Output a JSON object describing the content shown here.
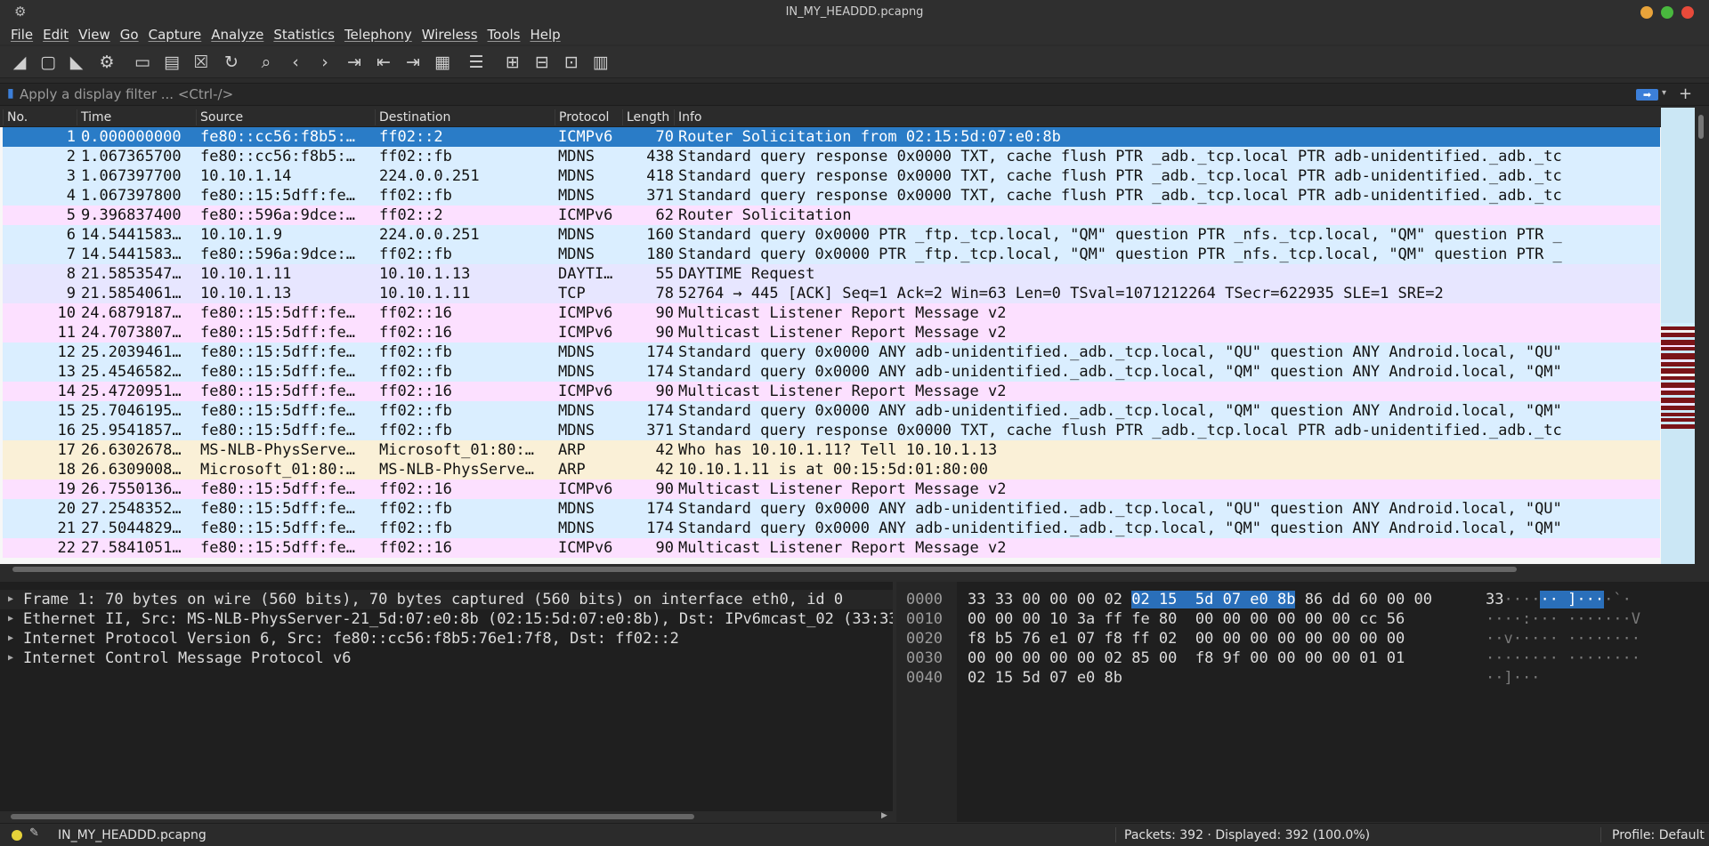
{
  "window": {
    "title": "IN_MY_HEADDD.pcapng"
  },
  "menu": [
    "File",
    "Edit",
    "View",
    "Go",
    "Capture",
    "Analyze",
    "Statistics",
    "Telephony",
    "Wireless",
    "Tools",
    "Help"
  ],
  "filter": {
    "placeholder": "Apply a display filter ... <Ctrl-/>"
  },
  "columns": [
    "No.",
    "Time",
    "Source",
    "Destination",
    "Protocol",
    "Length",
    "Info"
  ],
  "colors": {
    "selected": "#2a7cc7",
    "icmpv6": "#fce0ff",
    "udp": "#daeeff",
    "tcp": "#e7e6ff",
    "arp": "#faf0d7"
  },
  "packets": [
    {
      "no": "1",
      "time": "0.000000000",
      "src": "fe80::cc56:f8b5:…",
      "dst": "ff02::2",
      "proto": "ICMPv6",
      "len": "70",
      "info": "Router Solicitation from 02:15:5d:07:e0:8b",
      "color": "selected"
    },
    {
      "no": "2",
      "time": "1.067365700",
      "src": "fe80::cc56:f8b5:…",
      "dst": "ff02::fb",
      "proto": "MDNS",
      "len": "438",
      "info": "Standard query response 0x0000 TXT, cache flush PTR _adb._tcp.local PTR adb-unidentified._adb._tc",
      "color": "udp"
    },
    {
      "no": "3",
      "time": "1.067397700",
      "src": "10.10.1.14",
      "dst": "224.0.0.251",
      "proto": "MDNS",
      "len": "418",
      "info": "Standard query response 0x0000 TXT, cache flush PTR _adb._tcp.local PTR adb-unidentified._adb._tc",
      "color": "udp"
    },
    {
      "no": "4",
      "time": "1.067397800",
      "src": "fe80::15:5dff:fe…",
      "dst": "ff02::fb",
      "proto": "MDNS",
      "len": "371",
      "info": "Standard query response 0x0000 TXT, cache flush PTR _adb._tcp.local PTR adb-unidentified._adb._tc",
      "color": "udp"
    },
    {
      "no": "5",
      "time": "9.396837400",
      "src": "fe80::596a:9dce:…",
      "dst": "ff02::2",
      "proto": "ICMPv6",
      "len": "62",
      "info": "Router Solicitation",
      "color": "icmpv6"
    },
    {
      "no": "6",
      "time": "14.5441583…",
      "src": "10.10.1.9",
      "dst": "224.0.0.251",
      "proto": "MDNS",
      "len": "160",
      "info": "Standard query 0x0000 PTR _ftp._tcp.local, \"QM\" question PTR _nfs._tcp.local, \"QM\" question PTR _",
      "color": "udp"
    },
    {
      "no": "7",
      "time": "14.5441583…",
      "src": "fe80::596a:9dce:…",
      "dst": "ff02::fb",
      "proto": "MDNS",
      "len": "180",
      "info": "Standard query 0x0000 PTR _ftp._tcp.local, \"QM\" question PTR _nfs._tcp.local, \"QM\" question PTR _",
      "color": "udp"
    },
    {
      "no": "8",
      "time": "21.5853547…",
      "src": "10.10.1.11",
      "dst": "10.10.1.13",
      "proto": "DAYTI…",
      "len": "55",
      "info": "DAYTIME Request",
      "color": "tcp"
    },
    {
      "no": "9",
      "time": "21.5854061…",
      "src": "10.10.1.13",
      "dst": "10.10.1.11",
      "proto": "TCP",
      "len": "78",
      "info": "52764 → 445 [ACK] Seq=1 Ack=2 Win=63 Len=0 TSval=1071212264 TSecr=622935 SLE=1 SRE=2",
      "color": "tcp"
    },
    {
      "no": "10",
      "time": "24.6879187…",
      "src": "fe80::15:5dff:fe…",
      "dst": "ff02::16",
      "proto": "ICMPv6",
      "len": "90",
      "info": "Multicast Listener Report Message v2",
      "color": "icmpv6"
    },
    {
      "no": "11",
      "time": "24.7073807…",
      "src": "fe80::15:5dff:fe…",
      "dst": "ff02::16",
      "proto": "ICMPv6",
      "len": "90",
      "info": "Multicast Listener Report Message v2",
      "color": "icmpv6"
    },
    {
      "no": "12",
      "time": "25.2039461…",
      "src": "fe80::15:5dff:fe…",
      "dst": "ff02::fb",
      "proto": "MDNS",
      "len": "174",
      "info": "Standard query 0x0000 ANY adb-unidentified._adb._tcp.local, \"QU\" question ANY Android.local, \"QU\"",
      "color": "udp"
    },
    {
      "no": "13",
      "time": "25.4546582…",
      "src": "fe80::15:5dff:fe…",
      "dst": "ff02::fb",
      "proto": "MDNS",
      "len": "174",
      "info": "Standard query 0x0000 ANY adb-unidentified._adb._tcp.local, \"QM\" question ANY Android.local, \"QM\"",
      "color": "udp"
    },
    {
      "no": "14",
      "time": "25.4720951…",
      "src": "fe80::15:5dff:fe…",
      "dst": "ff02::16",
      "proto": "ICMPv6",
      "len": "90",
      "info": "Multicast Listener Report Message v2",
      "color": "icmpv6"
    },
    {
      "no": "15",
      "time": "25.7046195…",
      "src": "fe80::15:5dff:fe…",
      "dst": "ff02::fb",
      "proto": "MDNS",
      "len": "174",
      "info": "Standard query 0x0000 ANY adb-unidentified._adb._tcp.local, \"QM\" question ANY Android.local, \"QM\"",
      "color": "udp"
    },
    {
      "no": "16",
      "time": "25.9541857…",
      "src": "fe80::15:5dff:fe…",
      "dst": "ff02::fb",
      "proto": "MDNS",
      "len": "371",
      "info": "Standard query response 0x0000 TXT, cache flush PTR _adb._tcp.local PTR adb-unidentified._adb._tc",
      "color": "udp"
    },
    {
      "no": "17",
      "time": "26.6302678…",
      "src": "MS-NLB-PhysServe…",
      "dst": "Microsoft_01:80:…",
      "proto": "ARP",
      "len": "42",
      "info": "Who has 10.10.1.11? Tell 10.10.1.13",
      "color": "arp"
    },
    {
      "no": "18",
      "time": "26.6309008…",
      "src": "Microsoft_01:80:…",
      "dst": "MS-NLB-PhysServe…",
      "proto": "ARP",
      "len": "42",
      "info": "10.10.1.11 is at 00:15:5d:01:80:00",
      "color": "arp"
    },
    {
      "no": "19",
      "time": "26.7550136…",
      "src": "fe80::15:5dff:fe…",
      "dst": "ff02::16",
      "proto": "ICMPv6",
      "len": "90",
      "info": "Multicast Listener Report Message v2",
      "color": "icmpv6"
    },
    {
      "no": "20",
      "time": "27.2548352…",
      "src": "fe80::15:5dff:fe…",
      "dst": "ff02::fb",
      "proto": "MDNS",
      "len": "174",
      "info": "Standard query 0x0000 ANY adb-unidentified._adb._tcp.local, \"QU\" question ANY Android.local, \"QU\"",
      "color": "udp"
    },
    {
      "no": "21",
      "time": "27.5044829…",
      "src": "fe80::15:5dff:fe…",
      "dst": "ff02::fb",
      "proto": "MDNS",
      "len": "174",
      "info": "Standard query 0x0000 ANY adb-unidentified._adb._tcp.local, \"QM\" question ANY Android.local, \"QM\"",
      "color": "udp"
    },
    {
      "no": "22",
      "time": "27.5841051…",
      "src": "fe80::15:5dff:fe…",
      "dst": "ff02::16",
      "proto": "ICMPv6",
      "len": "90",
      "info": "Multicast Listener Report Message v2",
      "color": "icmpv6"
    }
  ],
  "details": [
    "Frame 1: 70 bytes on wire (560 bits), 70 bytes captured (560 bits) on interface eth0, id 0",
    "Ethernet II, Src: MS-NLB-PhysServer-21_5d:07:e0:8b (02:15:5d:07:e0:8b), Dst: IPv6mcast_02 (33:33:00:00:00:02)",
    "Internet Protocol Version 6, Src: fe80::cc56:f8b5:76e1:7f8, Dst: ff02::2",
    "Internet Control Message Protocol v6"
  ],
  "bytes": [
    {
      "offset": "0000",
      "hex_pre": "33 33 00 00 00 02 ",
      "hex_hl": "02 15  5d 07 e0 8b",
      "hex_post": " 86 dd 60 00 00",
      "ascii_pre": "33",
      "ascii_dim1": "····",
      "ascii_hl": "·· ]···",
      "ascii_post": "·`·"
    },
    {
      "offset": "0010",
      "hex": "00 00 00 10 3a ff fe 80  00 00 00 00 00 00 cc 56",
      "ascii": "····:··· ·······V"
    },
    {
      "offset": "0020",
      "hex": "f8 b5 76 e1 07 f8 ff 02  00 00 00 00 00 00 00 00",
      "ascii": "··v····· ········"
    },
    {
      "offset": "0030",
      "hex": "00 00 00 00 00 02 85 00  f8 9f 00 00 00 00 01 01",
      "ascii": "········ ········"
    },
    {
      "offset": "0040",
      "hex": "02 15 5d 07 e0 8b",
      "ascii": "··]···"
    }
  ],
  "status": {
    "file": "IN_MY_HEADDD.pcapng",
    "packets": "Packets: 392 · Displayed: 392 (100.0%)",
    "profile": "Profile: Default"
  }
}
